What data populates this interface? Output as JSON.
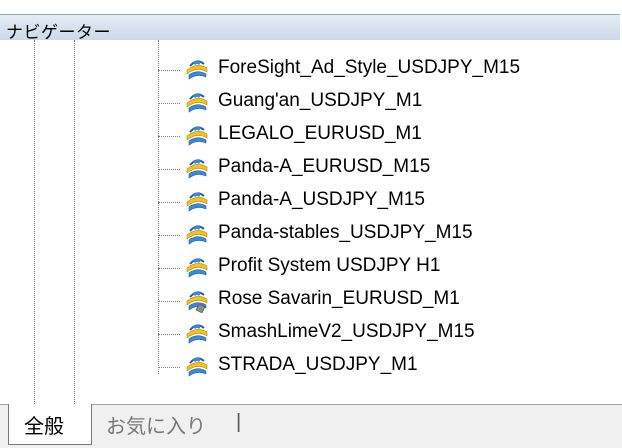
{
  "navigator": {
    "title": "ナビゲーター",
    "items": [
      {
        "label": "ForeSight_Ad_Style_USDJPY_M15",
        "icon": "expert-advisor-icon"
      },
      {
        "label": "Guang'an_USDJPY_M1",
        "icon": "expert-advisor-icon"
      },
      {
        "label": "LEGALO_EURUSD_M1",
        "icon": "expert-advisor-icon"
      },
      {
        "label": "Panda-A_EURUSD_M15",
        "icon": "expert-advisor-icon"
      },
      {
        "label": "Panda-A_USDJPY_M15",
        "icon": "expert-advisor-icon"
      },
      {
        "label": "Panda-stables_USDJPY_M15",
        "icon": "expert-advisor-icon"
      },
      {
        "label": "Profit System USDJPY H1",
        "icon": "expert-advisor-icon"
      },
      {
        "label": "Rose Savarin_EURUSD_M1",
        "icon": "expert-advisor-icon-gray"
      },
      {
        "label": "SmashLimeV2_USDJPY_M15",
        "icon": "expert-advisor-icon"
      },
      {
        "label": "STRADA_USDJPY_M1",
        "icon": "expert-advisor-icon"
      }
    ],
    "tabs": [
      {
        "label": "全般",
        "active": true
      },
      {
        "label": "お気に入り",
        "active": false
      }
    ],
    "tab_separator": "|"
  },
  "colors": {
    "title_bar": "#cdd9e8",
    "icon_blue": "#2f7fd0",
    "icon_yellow": "#f0c419"
  }
}
